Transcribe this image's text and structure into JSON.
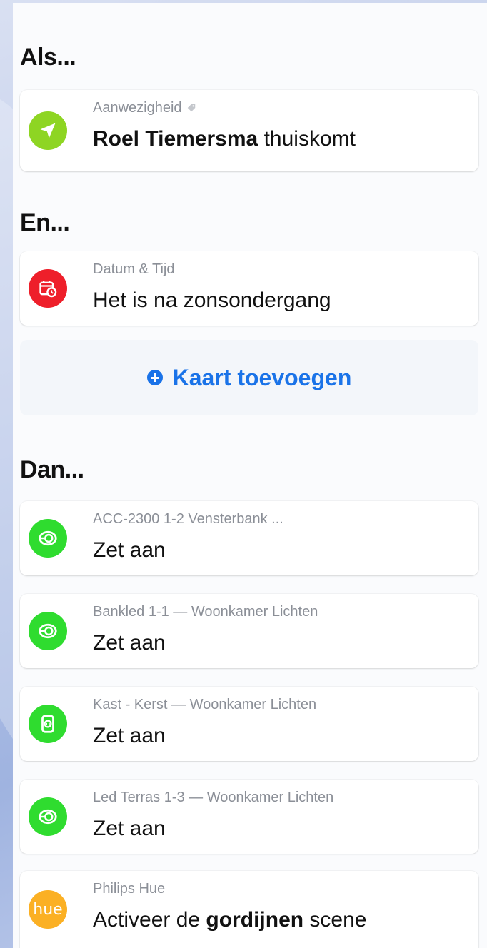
{
  "sections": {
    "if_title": "Als...",
    "and_title": "En...",
    "then_title": "Dan..."
  },
  "trigger": {
    "subtitle": "Aanwezigheid",
    "name": "Roel Tiemersma",
    "action": "thuiskomt",
    "icon": "location-arrow-icon",
    "icon_color": "#8ed523"
  },
  "condition": {
    "subtitle": "Datum & Tijd",
    "text": "Het is na zonsondergang",
    "icon": "calendar-clock-icon",
    "icon_color": "#ee1f2a"
  },
  "add_card": {
    "label": "Kaart toevoegen",
    "color": "#1a73e8"
  },
  "actions": [
    {
      "subtitle": "ACC-2300 1-2 Vensterbank ...",
      "text": "Zet aan",
      "icon": "light-socket-icon",
      "icon_color": "#2fdc2f"
    },
    {
      "subtitle": "Bankled 1-1 — Woonkamer Lichten",
      "text": "Zet aan",
      "icon": "light-socket-icon",
      "icon_color": "#2fdc2f"
    },
    {
      "subtitle": "Kast - Kerst — Woonkamer Lichten",
      "text": "Zet aan",
      "icon": "plug-icon",
      "icon_color": "#2fdc2f"
    },
    {
      "subtitle": "Led Terras 1-3 — Woonkamer Lichten",
      "text": "Zet aan",
      "icon": "light-socket-icon",
      "icon_color": "#2fdc2f"
    }
  ],
  "hue_action": {
    "subtitle": "Philips Hue",
    "prefix": "Activeer de",
    "scene": "gordijnen",
    "suffix": "scene",
    "icon_text": "hue",
    "icon_color": "#fbb024"
  }
}
